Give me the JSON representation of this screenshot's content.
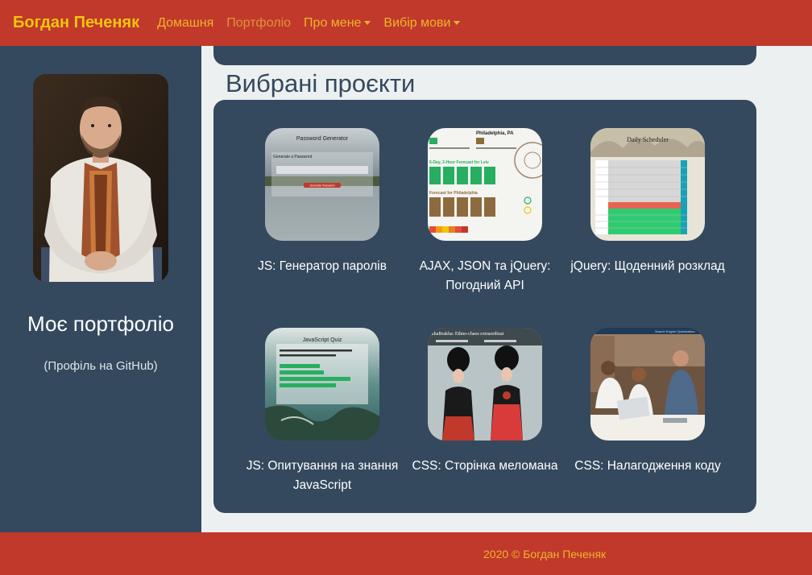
{
  "navbar": {
    "brand": "Богдан Печеняк",
    "items": [
      {
        "label": "Домашня"
      },
      {
        "label": "Портфоліо"
      },
      {
        "label": "Про мене"
      },
      {
        "label": "Вибір мови"
      }
    ]
  },
  "sidebar": {
    "title": "Моє портфоліо",
    "github_link": "(Профіль на GitHub)"
  },
  "main": {
    "section_title": "Вибрані проєкти",
    "projects": [
      {
        "label": "JS: Генератор паролів",
        "thumb_title": "Password Generator",
        "thumb_sub": "Generate a Password",
        "thumb_btn": "Generate Password"
      },
      {
        "label": "AJAX, JSON та jQuery: Погодний API",
        "thumb_title": "Philadelphia, PA",
        "thumb_sub": "5-Day, 3-Hour Forecast for Lviv",
        "thumb_sub2": "Forecast for Philadelphia"
      },
      {
        "label": "jQuery: Щоденний розклад",
        "thumb_title": "Daily Scheduler"
      },
      {
        "label": "JS: Опитування на знання JavaScript",
        "thumb_title": "JavaScript Quiz"
      },
      {
        "label": "CSS: Сторінка меломана",
        "thumb_title": "akhaBrakha: Ethno-chaos extraordinai"
      },
      {
        "label": "CSS: Налагодження коду",
        "thumb_title": "Search Engine Optimization"
      }
    ]
  },
  "footer": {
    "text": "2020 © Богдан Печеняк"
  }
}
